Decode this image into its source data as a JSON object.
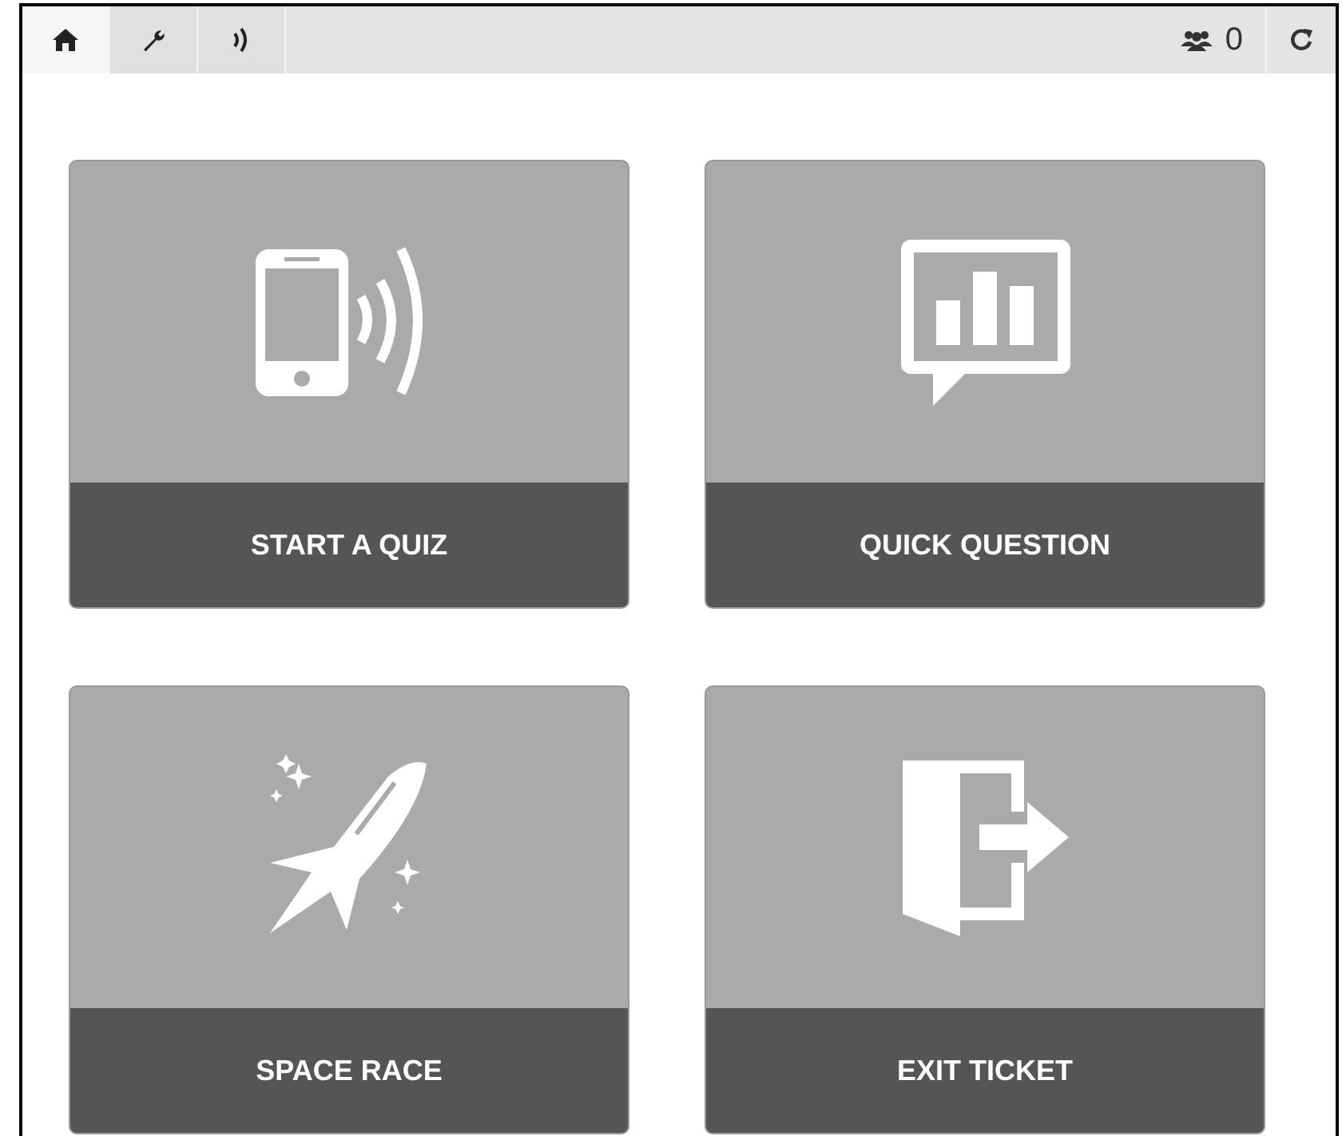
{
  "tabs": [
    {
      "kind": "home",
      "selected": true
    },
    {
      "kind": "wrench",
      "selected": false
    },
    {
      "kind": "signal",
      "selected": false
    }
  ],
  "students": {
    "count": "0"
  },
  "cards": [
    {
      "kind": "quiz",
      "label": "START A QUIZ"
    },
    {
      "kind": "question",
      "label": "QUICK QUESTION"
    },
    {
      "kind": "race",
      "label": "SPACE RACE"
    },
    {
      "kind": "exit",
      "label": "EXIT TICKET"
    }
  ]
}
